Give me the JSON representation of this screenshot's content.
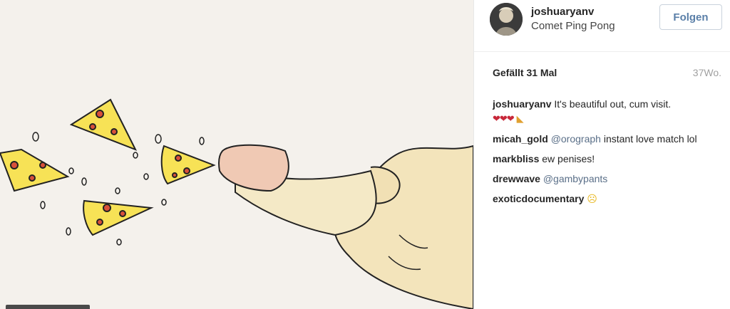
{
  "post": {
    "username": "joshuaryanv",
    "location": "Comet Ping Pong",
    "follow_label": "Folgen",
    "likes": "Gefällt 31 Mal",
    "time": "37Wo."
  },
  "comments": [
    {
      "author": "joshuaryanv",
      "text": "It's beautiful out, cum visit.",
      "emoji": "❤❤❤",
      "emoji2": "◣"
    },
    {
      "author": "micah_gold",
      "mention": "@orograph",
      "text": "instant love match lol"
    },
    {
      "author": "markbliss",
      "text": "ew penises!"
    },
    {
      "author": "drewwave",
      "mention": "@gambypants",
      "text": ""
    },
    {
      "author": "exoticdocumentary",
      "text": "",
      "emoji": "☹"
    }
  ],
  "colors": {
    "follow_text": "#5a7fa8",
    "mention": "#5a6f88",
    "time": "#a0a0a0"
  }
}
